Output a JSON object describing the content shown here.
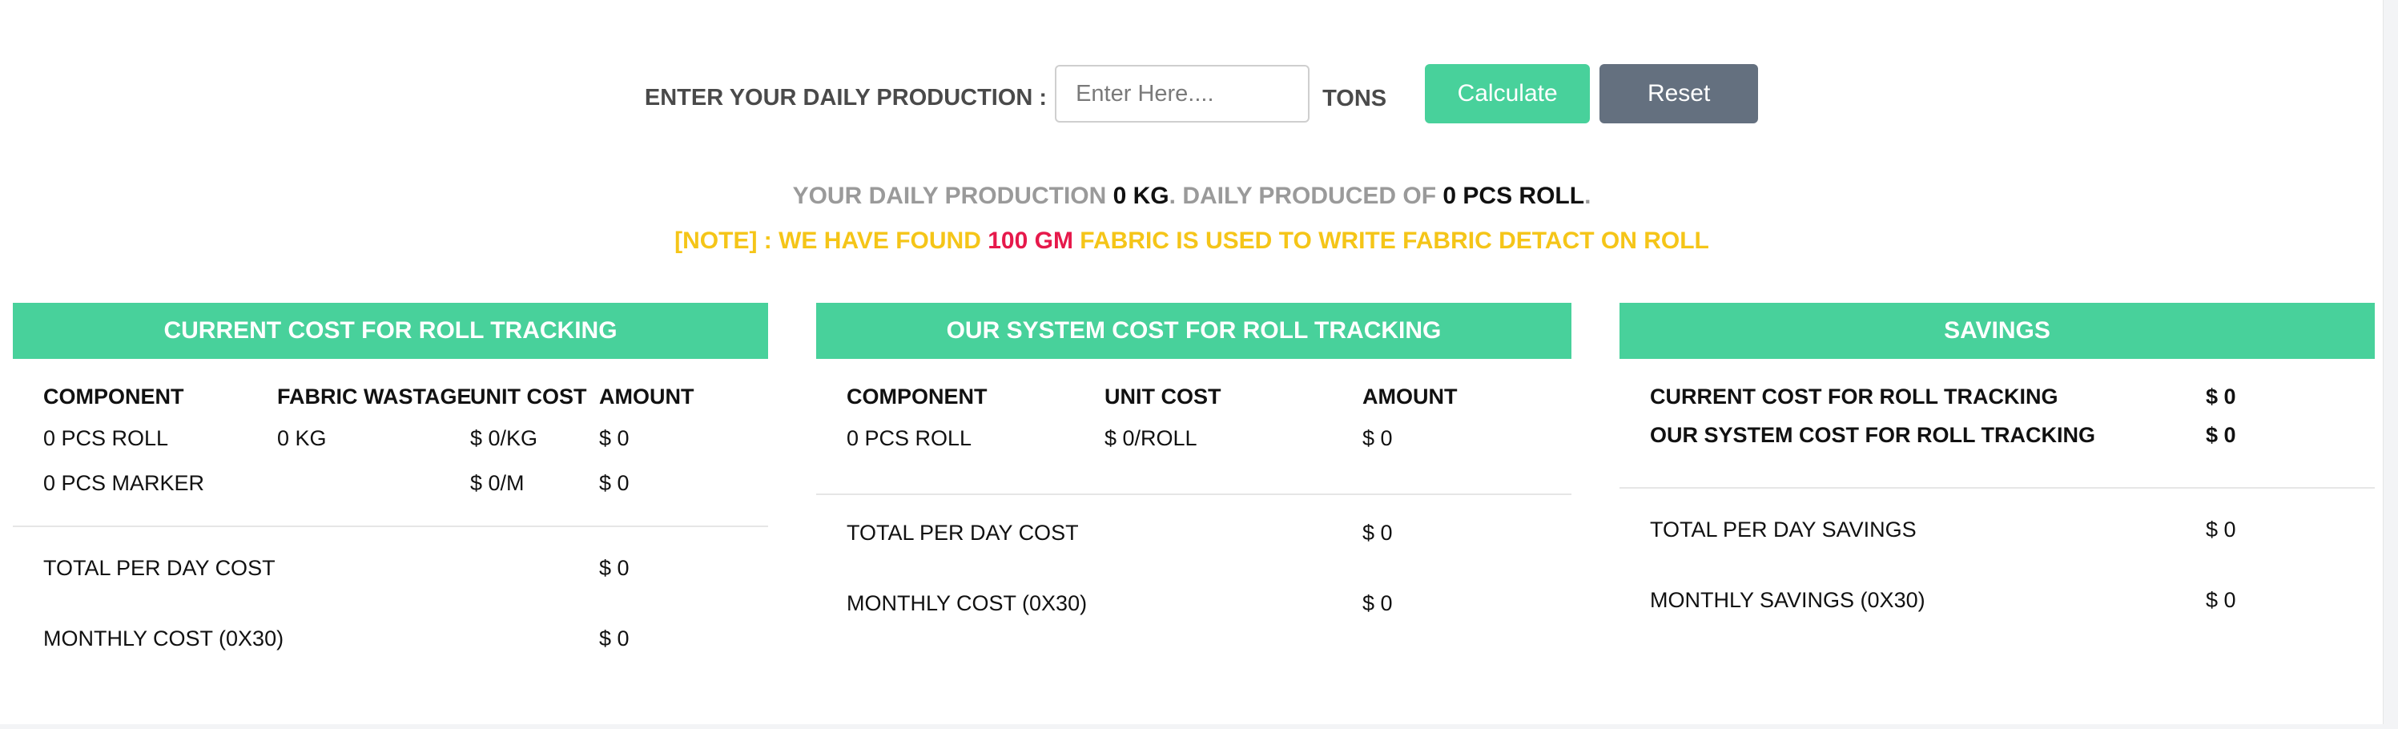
{
  "input": {
    "label": "ENTER YOUR DAILY PRODUCTION :",
    "placeholder": "Enter Here....",
    "unit": "TONS",
    "calculate_label": "Calculate",
    "reset_label": "Reset"
  },
  "summary": {
    "prefix": "YOUR DAILY PRODUCTION",
    "kg": "0 KG",
    "mid": ". DAILY PRODUCED OF",
    "rolls": "0 PCS ROLL",
    "suffix": "."
  },
  "note": {
    "prefix": "[NOTE] : WE HAVE FOUND",
    "amount": "100 GM",
    "suffix": "FABRIC IS USED TO WRITE FABRIC DETACT ON ROLL"
  },
  "current": {
    "title": "CURRENT COST FOR ROLL TRACKING",
    "headers": [
      "COMPONENT",
      "FABRIC WASTAGE",
      "UNIT COST",
      "AMOUNT"
    ],
    "rows": [
      [
        "0 PCS ROLL",
        "0 KG",
        "$ 0/KG",
        "$ 0"
      ],
      [
        "0 PCS MARKER",
        "",
        "$ 0/M",
        "$ 0"
      ]
    ],
    "total_label": "TOTAL PER DAY COST",
    "total_value": "$ 0",
    "monthly_label": "MONTHLY COST (0X30)",
    "monthly_value": "$ 0"
  },
  "system": {
    "title": "OUR SYSTEM COST FOR ROLL TRACKING",
    "headers": [
      "COMPONENT",
      "UNIT COST",
      "AMOUNT"
    ],
    "rows": [
      [
        "0 PCS ROLL",
        "$ 0/ROLL",
        "$ 0"
      ]
    ],
    "total_label": "TOTAL PER DAY COST",
    "total_value": "$ 0",
    "monthly_label": "MONTHLY COST (0X30)",
    "monthly_value": "$ 0"
  },
  "savings": {
    "title": "SAVINGS",
    "current_label": "CURRENT COST FOR ROLL TRACKING",
    "current_value": "$ 0",
    "system_label": "OUR SYSTEM COST FOR ROLL TRACKING",
    "system_value": "$ 0",
    "total_label": "TOTAL PER DAY SAVINGS",
    "total_value": "$ 0",
    "monthly_label": "MONTHLY SAVINGS (0X30)",
    "monthly_value": "$ 0"
  },
  "colors": {
    "accent": "#48d19b",
    "reset": "#64707f",
    "note": "#f5c518",
    "note_highlight": "#e6194b"
  }
}
